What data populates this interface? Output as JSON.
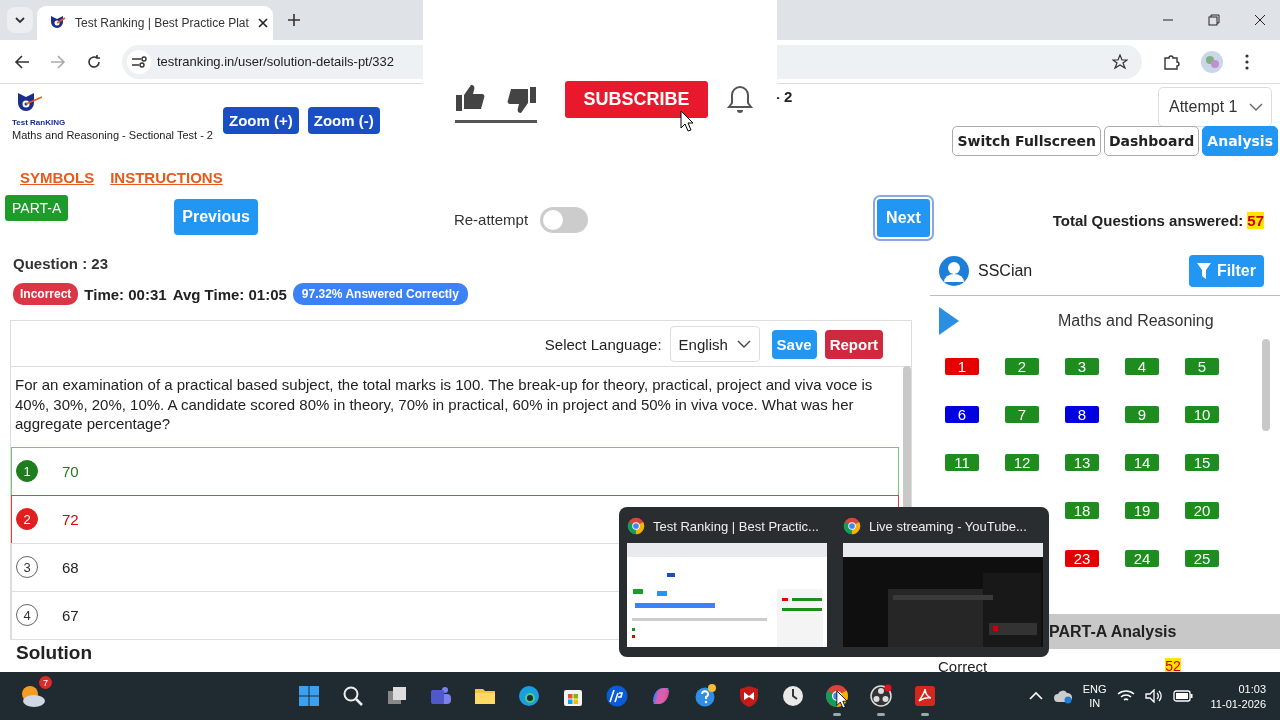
{
  "browser": {
    "tab_title": "Test Ranking | Best Practice Plat",
    "address": "testranking.in/user/solution-details-pt/332"
  },
  "video_overlay": {
    "subscribe": "SUBSCRIBE"
  },
  "header": {
    "logo_text": "Test RanKING",
    "subtitle": "Maths and Reasoning - Sectional Test - 2",
    "zoom_buttons": [
      "Zoom (+)",
      "Zoom (-)"
    ],
    "title_tail": "- 2",
    "attempt": "Attempt 1",
    "actions": [
      {
        "label": "Switch Fullscreen",
        "selected": false
      },
      {
        "label": "Dashboard",
        "selected": false
      },
      {
        "label": "Analysis",
        "selected": true
      }
    ]
  },
  "links": [
    "SYMBOLS",
    "INSTRUCTIONS"
  ],
  "section": "PART-A",
  "nav": {
    "previous": "Previous",
    "reattempt_label": "Re-attempt",
    "reattempt_on": false,
    "next": "Next"
  },
  "total": {
    "label": "Total Questions answered:",
    "value": "57"
  },
  "question": {
    "number_label": "Question : 23",
    "result": "Incorrect",
    "time": "Time: 00:31",
    "avg_time": "Avg Time: 01:05",
    "accuracy": "97.32% Answered Correctly",
    "language_label": "Select Language:",
    "language": "English",
    "save": "Save",
    "report": "Report",
    "text": "For an examination of a practical based subject, the total marks is 100. The break-up for theory, practical, project and viva voce is 40%, 30%, 20%, 10%. A candidate scored 80% in theory, 70% in practical, 60% in project and 50% in viva voce. What was her aggregate percentage?",
    "options": [
      {
        "index": "1",
        "text": "70",
        "correct": true,
        "selected": false
      },
      {
        "index": "2",
        "text": "72",
        "correct": false,
        "selected": true
      },
      {
        "index": "3",
        "text": "68",
        "correct": false,
        "selected": false
      },
      {
        "index": "4",
        "text": "67",
        "correct": false,
        "selected": false
      }
    ]
  },
  "solution_heading": "Solution",
  "sidebar": {
    "user": "SSCian",
    "filter": "Filter",
    "section_title": "Maths and Reasoning",
    "question_rows": [
      [
        {
          "label": "1",
          "color": "#e60000"
        },
        {
          "label": "2",
          "color": "#1e8c1e"
        },
        {
          "label": "3",
          "color": "#1e8c1e"
        },
        {
          "label": "4",
          "color": "#1e8c1e"
        },
        {
          "label": "5",
          "color": "#1e8c1e"
        }
      ],
      [
        {
          "label": "6",
          "color": "#0000e0"
        },
        {
          "label": "7",
          "color": "#1e8c1e"
        },
        {
          "label": "8",
          "color": "#0000e0"
        },
        {
          "label": "9",
          "color": "#1e8c1e"
        },
        {
          "label": "10",
          "color": "#1e8c1e"
        }
      ],
      [
        {
          "label": "11",
          "color": "#1e8c1e"
        },
        {
          "label": "12",
          "color": "#1e8c1e"
        },
        {
          "label": "13",
          "color": "#1e8c1e"
        },
        {
          "label": "14",
          "color": "#1e8c1e"
        },
        {
          "label": "15",
          "color": "#1e8c1e"
        }
      ],
      [
        {
          "label": "18",
          "color": "#1e8c1e"
        },
        {
          "label": "19",
          "color": "#1e8c1e"
        },
        {
          "label": "20",
          "color": "#1e8c1e"
        }
      ],
      [
        {
          "label": "23",
          "color": "#e60000"
        },
        {
          "label": "24",
          "color": "#1e8c1e"
        },
        {
          "label": "25",
          "color": "#1e8c1e"
        }
      ]
    ],
    "analysis_title": "PART-A Analysis",
    "analysis_rows": [
      {
        "label": "Correct",
        "value": "52"
      }
    ]
  },
  "switcher": [
    {
      "title": "Test Ranking | Best Practic...",
      "kind": "picture"
    },
    {
      "title": "Live streaming - YouTube...",
      "kind": "picture"
    }
  ],
  "taskbar": {
    "weather_badge": "7",
    "apps": [
      {
        "kind": "start",
        "running": false
      },
      {
        "kind": "search",
        "running": false
      },
      {
        "kind": "taskview",
        "running": false
      },
      {
        "kind": "teams",
        "running": false
      },
      {
        "kind": "explorer",
        "running": false
      },
      {
        "kind": "edge",
        "running": false
      },
      {
        "kind": "store",
        "running": false
      },
      {
        "kind": "hp",
        "running": false
      },
      {
        "kind": "copilot",
        "running": false
      },
      {
        "kind": "help",
        "running": false
      },
      {
        "kind": "shield",
        "running": false
      },
      {
        "kind": "clock",
        "running": false
      },
      {
        "kind": "chrome",
        "running": true
      },
      {
        "kind": "obs",
        "running": true
      },
      {
        "kind": "acrobat",
        "running": true
      }
    ],
    "language": [
      "ENG",
      "IN"
    ],
    "time": "01:03",
    "date": "11-01-2026"
  }
}
